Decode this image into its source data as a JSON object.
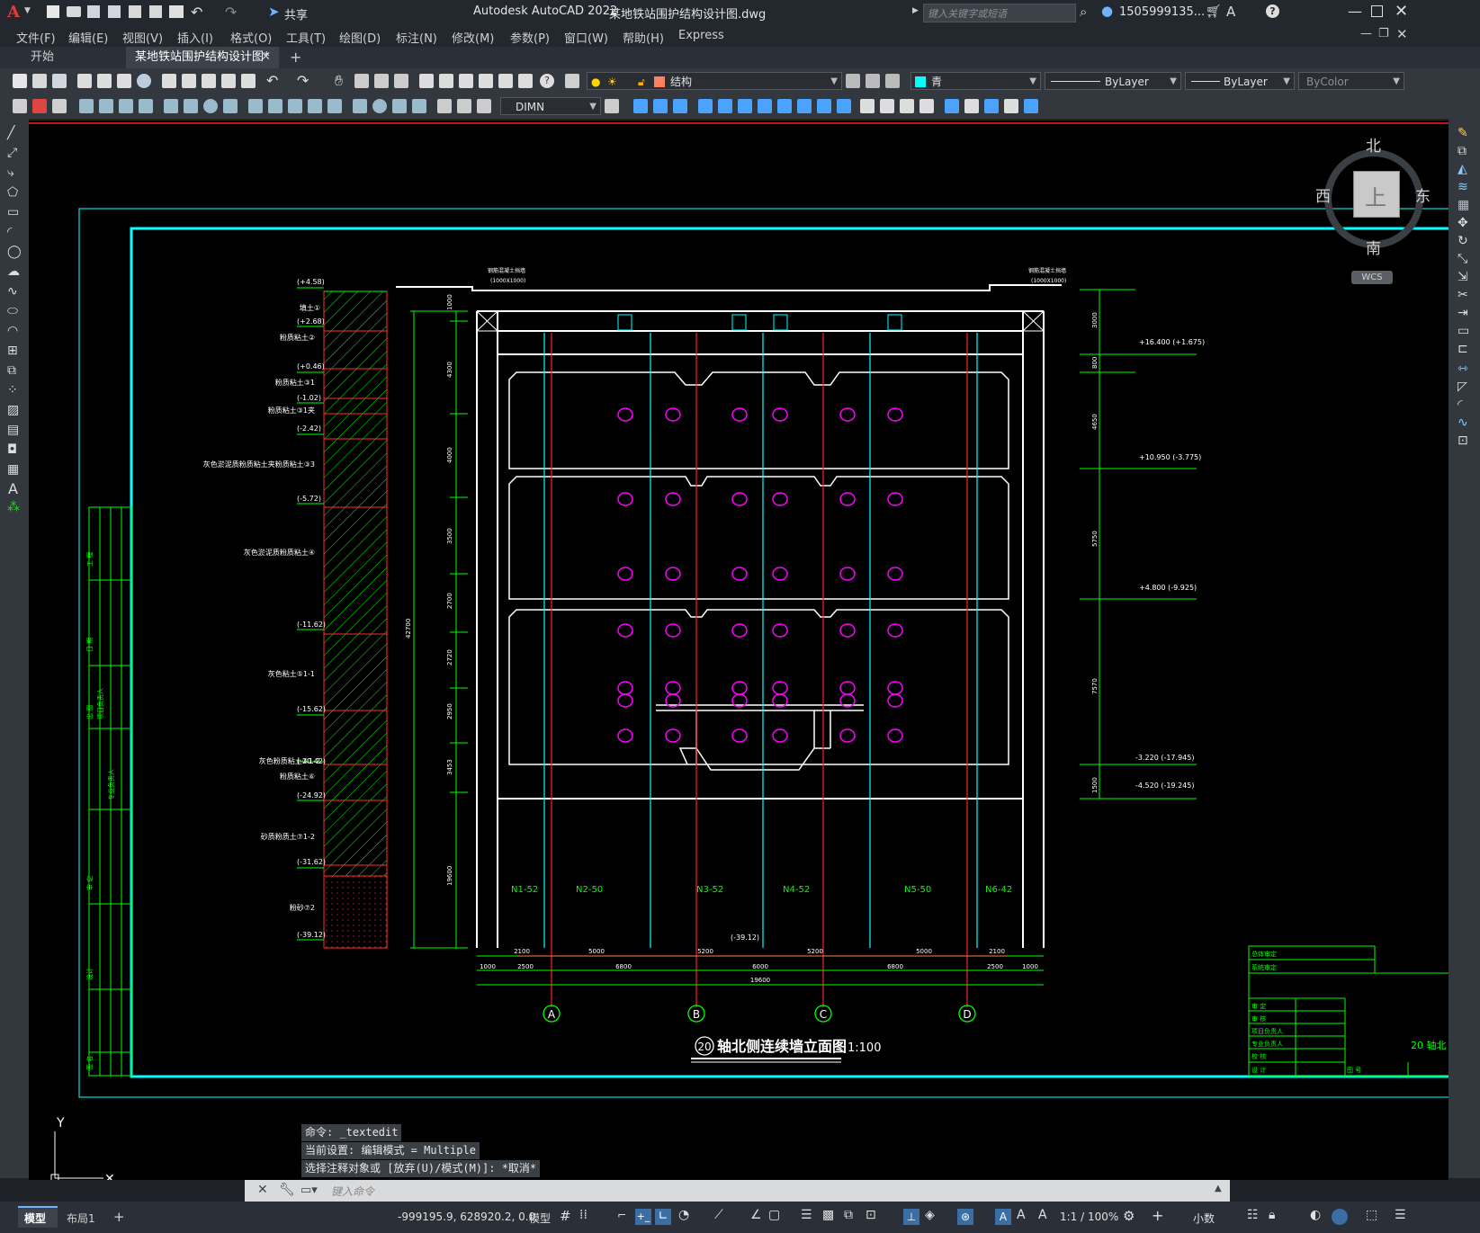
{
  "app": {
    "logo": "A",
    "title": "Autodesk AutoCAD 2022",
    "document": "某地铁站围护结构设计图.dwg",
    "share_label": "共享",
    "search_placeholder": "键入关键字或短语",
    "user": "1505999135..."
  },
  "menu": [
    "文件(F)",
    "编辑(E)",
    "视图(V)",
    "插入(I)",
    "格式(O)",
    "工具(T)",
    "绘图(D)",
    "标注(N)",
    "修改(M)",
    "参数(P)",
    "窗口(W)",
    "帮助(H)",
    "Express"
  ],
  "tabs": {
    "start": "开始",
    "active": "某地铁站围护结构设计图*",
    "add": "+"
  },
  "toolbar": {
    "layer": "结构",
    "color": "青",
    "linetype": "ByLayer",
    "lineweight": "ByLayer",
    "plotstyle": "ByColor",
    "dimstyle": "DIMN"
  },
  "viewcube": {
    "north": "北",
    "south": "南",
    "east": "东",
    "west": "西",
    "top": "上",
    "wcs": "WCS"
  },
  "drawing": {
    "title_num": "20",
    "title": "轴北侧连续墙立面图",
    "scale": "1:100",
    "levels_left": [
      "(+4.58)",
      "(+2.68)",
      "(+0.46)",
      "(-1.02)",
      "(-2.42)",
      "(-5.72)",
      "(-11.62)",
      "(-15.62)",
      "(-20.42)",
      "(-24.92)",
      "(-31.62)",
      "(-39.12)"
    ],
    "soils": [
      "填土①",
      "粉质粘土②",
      "粉质粘土③1",
      "粉质粘土③1夹",
      "灰色淤泥质粉质粘土夹粉质粘土③3",
      "灰色淤泥质粉质粘土④",
      "灰色粘土⑤1-1",
      "灰色粉质粘土⑤1-2",
      "粉质粘土⑥",
      "砂质粉质土⑦1-2",
      "粉砂⑦2"
    ],
    "left_dims": [
      "1000",
      "4300",
      "4000",
      "3500",
      "2700",
      "2720",
      "2950",
      "3453",
      "19600",
      "42700"
    ],
    "right_dims": [
      "3000",
      "800",
      "4650",
      "5750",
      "7570",
      "1500"
    ],
    "right_levels": [
      "+16.400 (+1.675)",
      "+10.950 (-3.775)",
      "+4.800 (-9.925)",
      "-3.220 (-17.945)",
      "-4.520 (-19.245)"
    ],
    "panels": [
      "N1-52",
      "N2-50",
      "N3-52",
      "N4-52",
      "N5-50",
      "N6-42"
    ],
    "bottom_level": "(-39.12)",
    "dims_row1": [
      "2100",
      "5000",
      "5200",
      "5200",
      "5000",
      "2100"
    ],
    "dims_row2": [
      "1000",
      "2500",
      "6800",
      "6000",
      "6800",
      "2500",
      "1000"
    ],
    "dims_total": "19600",
    "axes": [
      "A",
      "B",
      "C",
      "D"
    ],
    "notes_top": [
      "钢筋混凝土挡墙",
      "(1000X1000)"
    ],
    "titleblock": [
      "总体审定",
      "系统审定",
      "审 定",
      "审 核",
      "项目负责人",
      "专业负责人",
      "校 核",
      "设 计",
      "图 号",
      "20 轴北"
    ],
    "side_table": [
      "工 程",
      "日 期",
      "出 图",
      "项目负责人",
      "专业负责人",
      "审 定",
      "设计",
      "签 名"
    ]
  },
  "command": {
    "history": [
      "命令: _textedit",
      "当前设置: 编辑模式 = Multiple",
      "选择注释对象或 [放弃(U)/模式(M)]: *取消*"
    ],
    "placeholder": "键入命令"
  },
  "layout_tabs": [
    "模型",
    "布局1",
    "+"
  ],
  "status": {
    "coords": "-999195.9, 628920.2, 0.0",
    "mode": "模型",
    "scale": "1:1 / 100%",
    "units": "小数"
  },
  "colors": {
    "cyan": "#00ffff",
    "green": "#00ff00",
    "red": "#ff2020",
    "magenta": "#ff00ff",
    "white": "#ffffff"
  }
}
